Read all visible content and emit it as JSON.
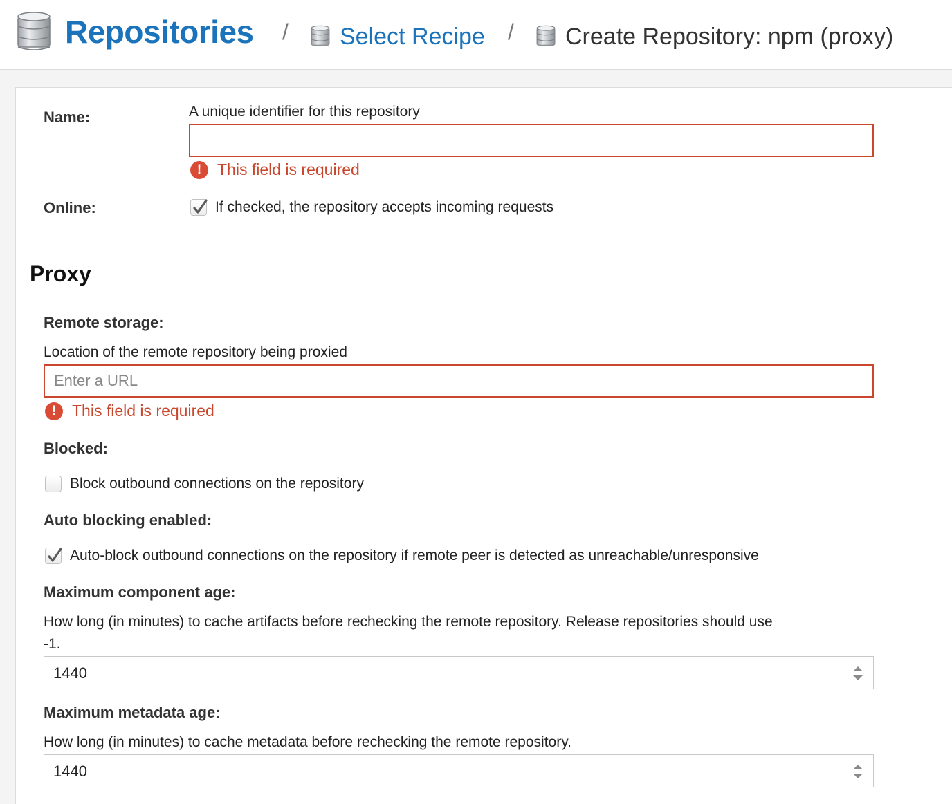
{
  "breadcrumb": {
    "root_label": "Repositories",
    "separator": "/",
    "step2_label": "Select Recipe",
    "step3_label": "Create Repository: npm (proxy)"
  },
  "form": {
    "name": {
      "label": "Name:",
      "help": "A unique identifier for this repository",
      "value": "",
      "error": "This field is required"
    },
    "online": {
      "label": "Online:",
      "checked": true,
      "help": "If checked, the repository accepts incoming requests"
    },
    "proxy": {
      "title": "Proxy",
      "remote_storage": {
        "label": "Remote storage:",
        "help": "Location of the remote repository being proxied",
        "placeholder": "Enter a URL",
        "error": "This field is required"
      },
      "blocked": {
        "label": "Blocked:",
        "checked": false,
        "help": "Block outbound connections on the repository"
      },
      "auto_blocking": {
        "label": "Auto blocking enabled:",
        "checked": true,
        "help": "Auto-block outbound connections on the repository if remote peer is detected as unreachable/unresponsive"
      },
      "max_component_age": {
        "label": "Maximum component age:",
        "help_line1": "How long (in minutes) to cache artifacts before rechecking the remote repository. Release repositories should use",
        "help_line2": "-1.",
        "value": "1440"
      },
      "max_metadata_age": {
        "label": "Maximum metadata age:",
        "help": "How long (in minutes) to cache metadata before rechecking the remote repository.",
        "value": "1440"
      }
    }
  },
  "icons": {
    "breadcrumb": "database-icon",
    "error": "exclamation-circle-icon",
    "checkmark": "checkmark-icon",
    "spinner": "spinner-arrows-icon"
  },
  "colors": {
    "link_blue": "#1b73bb",
    "error_red": "#c9472d",
    "error_icon": "#d94b35"
  }
}
